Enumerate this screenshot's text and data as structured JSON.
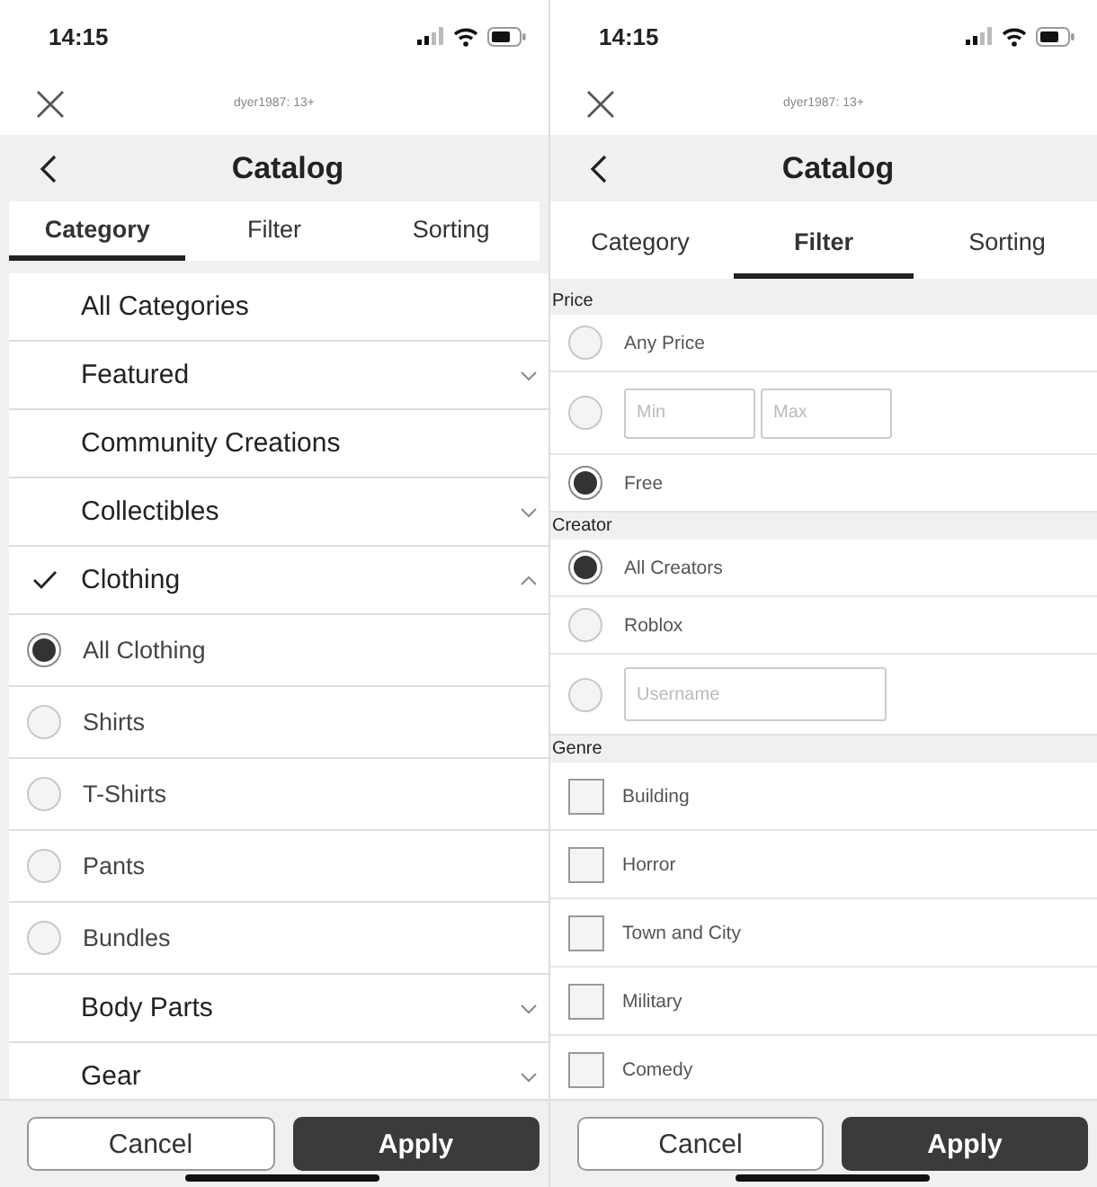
{
  "screens": [
    {
      "status_bar": {
        "time": "14:15"
      },
      "account": "dyer1987: 13+",
      "title": "Catalog",
      "tabs": [
        {
          "label": "Category",
          "selected": true
        },
        {
          "label": "Filter",
          "selected": false
        },
        {
          "label": "Sorting",
          "selected": false
        }
      ],
      "kind": "categories",
      "categories": [
        {
          "kind": "link",
          "label": "All Categories",
          "checked": false
        },
        {
          "kind": "group",
          "label": "Featured",
          "checked": false,
          "expanded": false
        },
        {
          "kind": "link",
          "label": "Community Creations",
          "checked": false
        },
        {
          "kind": "group",
          "label": "Collectibles",
          "checked": false,
          "expanded": false
        },
        {
          "kind": "group",
          "label": "Clothing",
          "checked": true,
          "expanded": true,
          "children": [
            {
              "label": "All Clothing",
              "selected": true
            },
            {
              "label": "Shirts",
              "selected": false
            },
            {
              "label": "T-Shirts",
              "selected": false
            },
            {
              "label": "Pants",
              "selected": false
            },
            {
              "label": "Bundles",
              "selected": false
            }
          ]
        },
        {
          "kind": "group",
          "label": "Body Parts",
          "checked": false,
          "expanded": false
        },
        {
          "kind": "group",
          "label": "Gear",
          "checked": false,
          "expanded": false
        }
      ],
      "buttons": [
        {
          "label": "Cancel",
          "kind": "secondary"
        },
        {
          "label": "Apply",
          "kind": "primary"
        }
      ]
    },
    {
      "status_bar": {
        "time": "14:15"
      },
      "account": "dyer1987: 13+",
      "title": "Catalog",
      "tabs": [
        {
          "label": "Category",
          "selected": false
        },
        {
          "label": "Filter",
          "selected": true
        },
        {
          "label": "Sorting",
          "selected": false
        }
      ],
      "kind": "filter",
      "sections": [
        {
          "title": "Price",
          "rows": [
            {
              "kind": "radio",
              "label": "Any Price",
              "selected": false
            },
            {
              "kind": "range",
              "selected": false,
              "min_placeholder": "Min",
              "max_placeholder": "Max"
            },
            {
              "kind": "radio",
              "label": "Free",
              "selected": true
            }
          ]
        },
        {
          "title": "Creator",
          "rows": [
            {
              "kind": "radio",
              "label": "All Creators",
              "selected": true
            },
            {
              "kind": "radio",
              "label": "Roblox",
              "selected": false
            },
            {
              "kind": "text-input",
              "selected": false,
              "placeholder": "Username"
            }
          ]
        },
        {
          "title": "Genre",
          "rows": [
            {
              "kind": "checkbox",
              "label": "Building",
              "checked": false
            },
            {
              "kind": "checkbox",
              "label": "Horror",
              "checked": false
            },
            {
              "kind": "checkbox",
              "label": "Town and City",
              "checked": false
            },
            {
              "kind": "checkbox",
              "label": "Military",
              "checked": false
            },
            {
              "kind": "checkbox",
              "label": "Comedy",
              "checked": false
            }
          ]
        }
      ],
      "buttons": [
        {
          "label": "Cancel",
          "kind": "secondary"
        },
        {
          "label": "Apply",
          "kind": "primary"
        }
      ]
    }
  ]
}
